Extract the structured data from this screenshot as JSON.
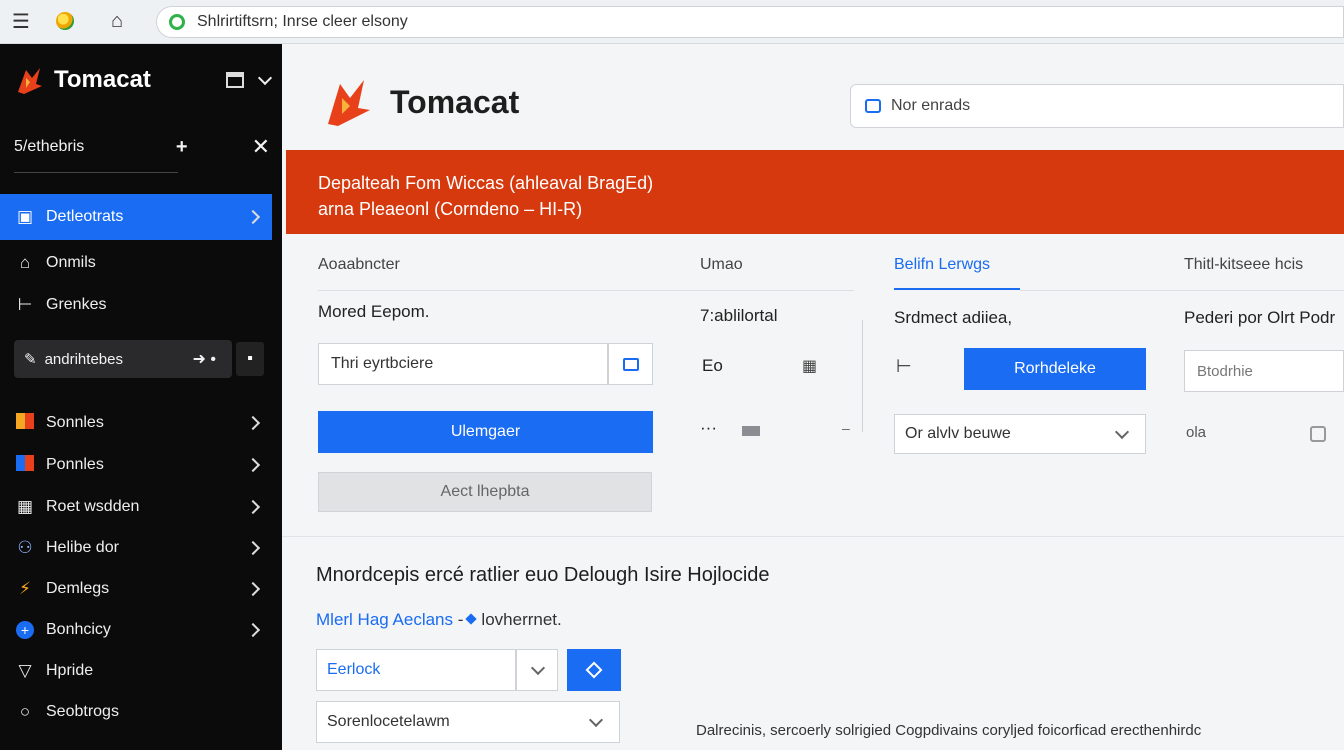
{
  "browser": {
    "url": "Shlrirtiftsrn; Inrse cleer elsony"
  },
  "sidebar": {
    "brand": "Tomacat",
    "section_label": "5/ethebris",
    "pill_label": "andrihtebes",
    "items": [
      {
        "label": "Detleotrats",
        "icon": "grid-icon",
        "active": true
      },
      {
        "label": "Onmils",
        "icon": "home-icon"
      },
      {
        "label": "Grenkes",
        "icon": "branch-icon"
      },
      {
        "label": "Sonnles",
        "icon": "orange-square-icon"
      },
      {
        "label": "Ponnles",
        "icon": "red-blue-square-icon"
      },
      {
        "label": "Roet wsdden",
        "icon": "window-icon"
      },
      {
        "label": "Helibe dor",
        "icon": "people-icon"
      },
      {
        "label": "Demlegs",
        "icon": "bolt-icon"
      },
      {
        "label": "Bonhcicy",
        "icon": "plus-circle-icon"
      },
      {
        "label": "Hpride",
        "icon": "shield-icon"
      },
      {
        "label": "Seobtrogs",
        "icon": "circle-icon"
      }
    ]
  },
  "main": {
    "brand": "Tomacat",
    "search_placeholder": "Nor enrads",
    "banner": {
      "line1": "Depalteah Fom Wiccas (ahleaval BragEd)",
      "line2": "arna Pleaeonl (Corndeno – HI-R)"
    },
    "columns": {
      "c1": "Aoaabncter",
      "c2": "Umao",
      "c3": "Belifn Lerwgs",
      "c4": "Thitl-kitseee hcis"
    },
    "col1": {
      "field_label": "Mored Eepom.",
      "input_value": "Thri eyrtbciere",
      "primary_btn": "Ulemgaer",
      "disabled_btn": "Aect lhepbta"
    },
    "col2": {
      "label": "7:ablilortal",
      "row2": "Eo",
      "row3": "···"
    },
    "col3": {
      "label": "Srdmect adiiea,",
      "btn": "Rorhdeleke",
      "select": "Or alvlv beuwe"
    },
    "col4": {
      "label": "Pederi por Olrt Podr",
      "input": "Btodrhie",
      "value": "ola"
    },
    "section": {
      "title": "Mnordcepis ercé ratlier euo Delough Isire Hojlocide",
      "sub_link": "Mlerl Hag Aeclans",
      "sub_text": "lovherrnet.",
      "select1": "Eerlock",
      "select2": "Sorenlocetelawm",
      "footer": "Dalrecinis, sercoerly solrigied Cogpdivains coryljed foicorficad erecthenhirdc"
    }
  }
}
